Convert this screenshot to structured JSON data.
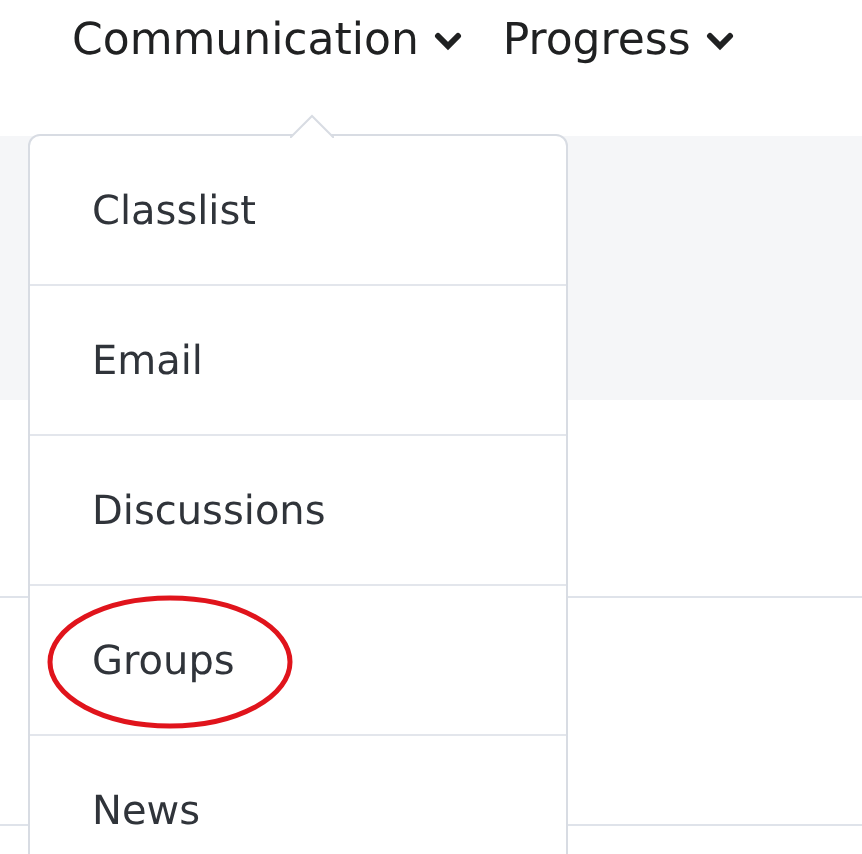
{
  "nav": [
    {
      "label": "Communication"
    },
    {
      "label": "Progress"
    }
  ],
  "menu": {
    "items": [
      {
        "label": "Classlist",
        "circled": false
      },
      {
        "label": "Email",
        "circled": false
      },
      {
        "label": "Discussions",
        "circled": false
      },
      {
        "label": "Groups",
        "circled": true
      },
      {
        "label": "News",
        "circled": false
      }
    ]
  }
}
